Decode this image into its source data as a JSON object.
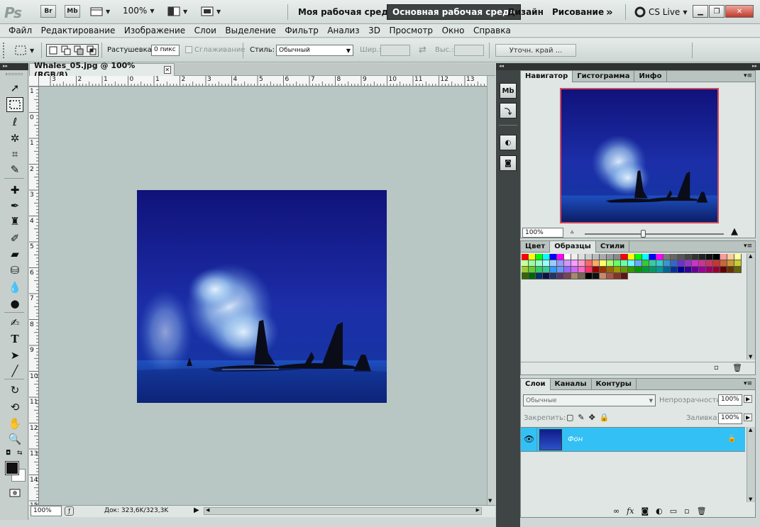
{
  "app": {
    "logo": "Ps",
    "bridge_label": "Br",
    "minibridge_label": "Mb",
    "zoom_value": "100%",
    "workspaces": [
      "Моя рабочая среда",
      "Основная рабочая среда",
      "Дизайн",
      "Рисование"
    ],
    "more_label": "»",
    "cslive_label": "CS Live"
  },
  "menu": [
    "Файл",
    "Редактирование",
    "Изображение",
    "Слои",
    "Выделение",
    "Фильтр",
    "Анализ",
    "3D",
    "Просмотр",
    "Окно",
    "Справка"
  ],
  "options": {
    "feather_label": "Растушевка:",
    "feather_value": "0 пикс",
    "antialias_label": "Сглаживание",
    "style_label": "Стиль:",
    "style_value": "Обычный",
    "width_label": "Шир.:",
    "height_label": "Выс.:",
    "refine_label": "Уточн. край ..."
  },
  "document": {
    "tab_title": "Whales_05.jpg @ 100% (RGB/8)",
    "ruler_top_numbers": [
      "3",
      "2",
      "1",
      "0",
      "1",
      "2",
      "3",
      "4",
      "5",
      "6",
      "7",
      "8",
      "9",
      "10",
      "11",
      "12",
      "13"
    ],
    "ruler_left_numbers": [
      "1",
      "0",
      "1",
      "2",
      "3",
      "4",
      "5",
      "6",
      "7",
      "8",
      "9",
      "10",
      "11",
      "12",
      "13",
      "14",
      "15"
    ],
    "status_zoom": "100%",
    "status_doc": "Док: 323,6K/323,3K"
  },
  "navigator": {
    "tabs": [
      "Навигатор",
      "Гистограмма",
      "Инфо"
    ],
    "zoom_value": "100%",
    "slider_position": 0.42
  },
  "swatches": {
    "tabs": [
      "Цвет",
      "Образцы",
      "Стили"
    ],
    "colors": [
      "#ff0000",
      "#ffff00",
      "#00ff00",
      "#00ffff",
      "#0000ff",
      "#ff00ff",
      "#ffffff",
      "#eeeeee",
      "#dddddd",
      "#cccccc",
      "#bbbbbb",
      "#aaaaaa",
      "#999999",
      "#888888",
      "#ff0000",
      "#ffff00",
      "#00ff00",
      "#00ffff",
      "#0000ff",
      "#ff00ff",
      "#777777",
      "#666666",
      "#555555",
      "#444444",
      "#333333",
      "#222222",
      "#111111",
      "#000000",
      "#ff9999",
      "#ffcc99",
      "#ffff99",
      "#ccff99",
      "#99ff99",
      "#99ffcc",
      "#99ffff",
      "#99ccff",
      "#9999ff",
      "#cc99ff",
      "#ff99ff",
      "#ff99cc",
      "#ff6666",
      "#ffaa66",
      "#ffff66",
      "#aaff66",
      "#66ff66",
      "#66ffaa",
      "#66ffff",
      "#66aaff",
      "#33cc33",
      "#33ccaa",
      "#33cccc",
      "#3399cc",
      "#3366cc",
      "#6633cc",
      "#9933cc",
      "#cc33cc",
      "#cc3399",
      "#cc3366",
      "#cc3333",
      "#cc6633",
      "#cc9933",
      "#cccc33",
      "#99cc33",
      "#66cc33",
      "#33cc66",
      "#33cc99",
      "#3399ff",
      "#6699ff",
      "#9966ff",
      "#cc66ff",
      "#ff66cc",
      "#ff3366",
      "#990000",
      "#993300",
      "#996600",
      "#999900",
      "#669900",
      "#339900",
      "#009900",
      "#009933",
      "#009966",
      "#009999",
      "#006699",
      "#003399",
      "#000099",
      "#330099",
      "#660099",
      "#990099",
      "#990066",
      "#990033",
      "#660000",
      "#663300",
      "#666600",
      "#336600",
      "#006600",
      "#003366",
      "#111144",
      "#223366",
      "#553366",
      "#774455",
      "#aa8866",
      "#776655",
      "#000000",
      "#111111",
      "#cc8866",
      "#aa5544",
      "#883322",
      "#661111"
    ]
  },
  "layers": {
    "tabs": [
      "Слои",
      "Каналы",
      "Контуры"
    ],
    "blend_mode": "Обычные",
    "opacity_label": "Непрозрачность:",
    "opacity_value": "100%",
    "lock_label": "Закрепить:",
    "fill_label": "Заливка:",
    "fill_value": "100%",
    "items": [
      {
        "name": "Фон",
        "locked": true,
        "visible": true
      }
    ]
  }
}
